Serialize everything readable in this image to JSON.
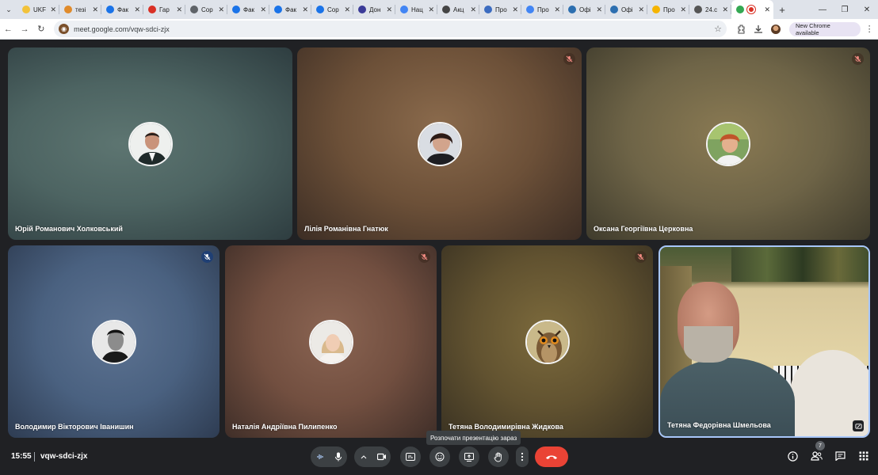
{
  "browser": {
    "tabs": [
      {
        "title": "UKF",
        "favicon_color": "#f2c23a",
        "active": false
      },
      {
        "title": "тезі",
        "favicon_color": "#e08b2c",
        "active": false
      },
      {
        "title": "Фак",
        "favicon_color": "#1a73e8",
        "active": false
      },
      {
        "title": "Гар",
        "favicon_color": "#d93025",
        "active": false
      },
      {
        "title": "Сор",
        "favicon_color": "#5f6368",
        "active": false
      },
      {
        "title": "Фак",
        "favicon_color": "#1a73e8",
        "active": false
      },
      {
        "title": "Фак",
        "favicon_color": "#1a73e8",
        "active": false
      },
      {
        "title": "Сор",
        "favicon_color": "#1a73e8",
        "active": false
      },
      {
        "title": "Дон",
        "favicon_color": "#3b3b98",
        "active": false
      },
      {
        "title": "Нац",
        "favicon_color": "#4285f4",
        "active": false
      },
      {
        "title": "Акц",
        "favicon_color": "#444444",
        "active": false
      },
      {
        "title": "Про",
        "favicon_color": "#3c6cc0",
        "active": false
      },
      {
        "title": "Про",
        "favicon_color": "#4285f4",
        "active": false
      },
      {
        "title": "Офі",
        "favicon_color": "#2d6fb0",
        "active": false
      },
      {
        "title": "Офі",
        "favicon_color": "#2d6fb0",
        "active": false
      },
      {
        "title": "Про",
        "favicon_color": "#f5b400",
        "active": false
      },
      {
        "title": "24.с",
        "favicon_color": "#555555",
        "active": false
      },
      {
        "title": "",
        "favicon_color": "#34a853",
        "active": true
      }
    ],
    "url": "meet.google.com/vqw-sdci-zjx",
    "new_chrome_label": "New Chrome available"
  },
  "participants": [
    {
      "name": "Юрій Романович Холковський",
      "muted": false
    },
    {
      "name": "Лілія Романівна Гнатюк",
      "muted": true
    },
    {
      "name": "Оксана Георгіївна Церковна",
      "muted": true
    },
    {
      "name": "Володимир Вікторович Іванишин",
      "muted": true
    },
    {
      "name": "Наталія Андріївна Пилипенко",
      "muted": true
    },
    {
      "name": "Тетяна Володимирівна Жидкова",
      "muted": true
    },
    {
      "name": "Тетяна Федорівна Шмельова",
      "muted": false
    }
  ],
  "meeting": {
    "time": "15:55",
    "code": "vqw-sdci-zjx",
    "participant_count": "7",
    "tooltip": "Розпочати презентацію зараз"
  }
}
